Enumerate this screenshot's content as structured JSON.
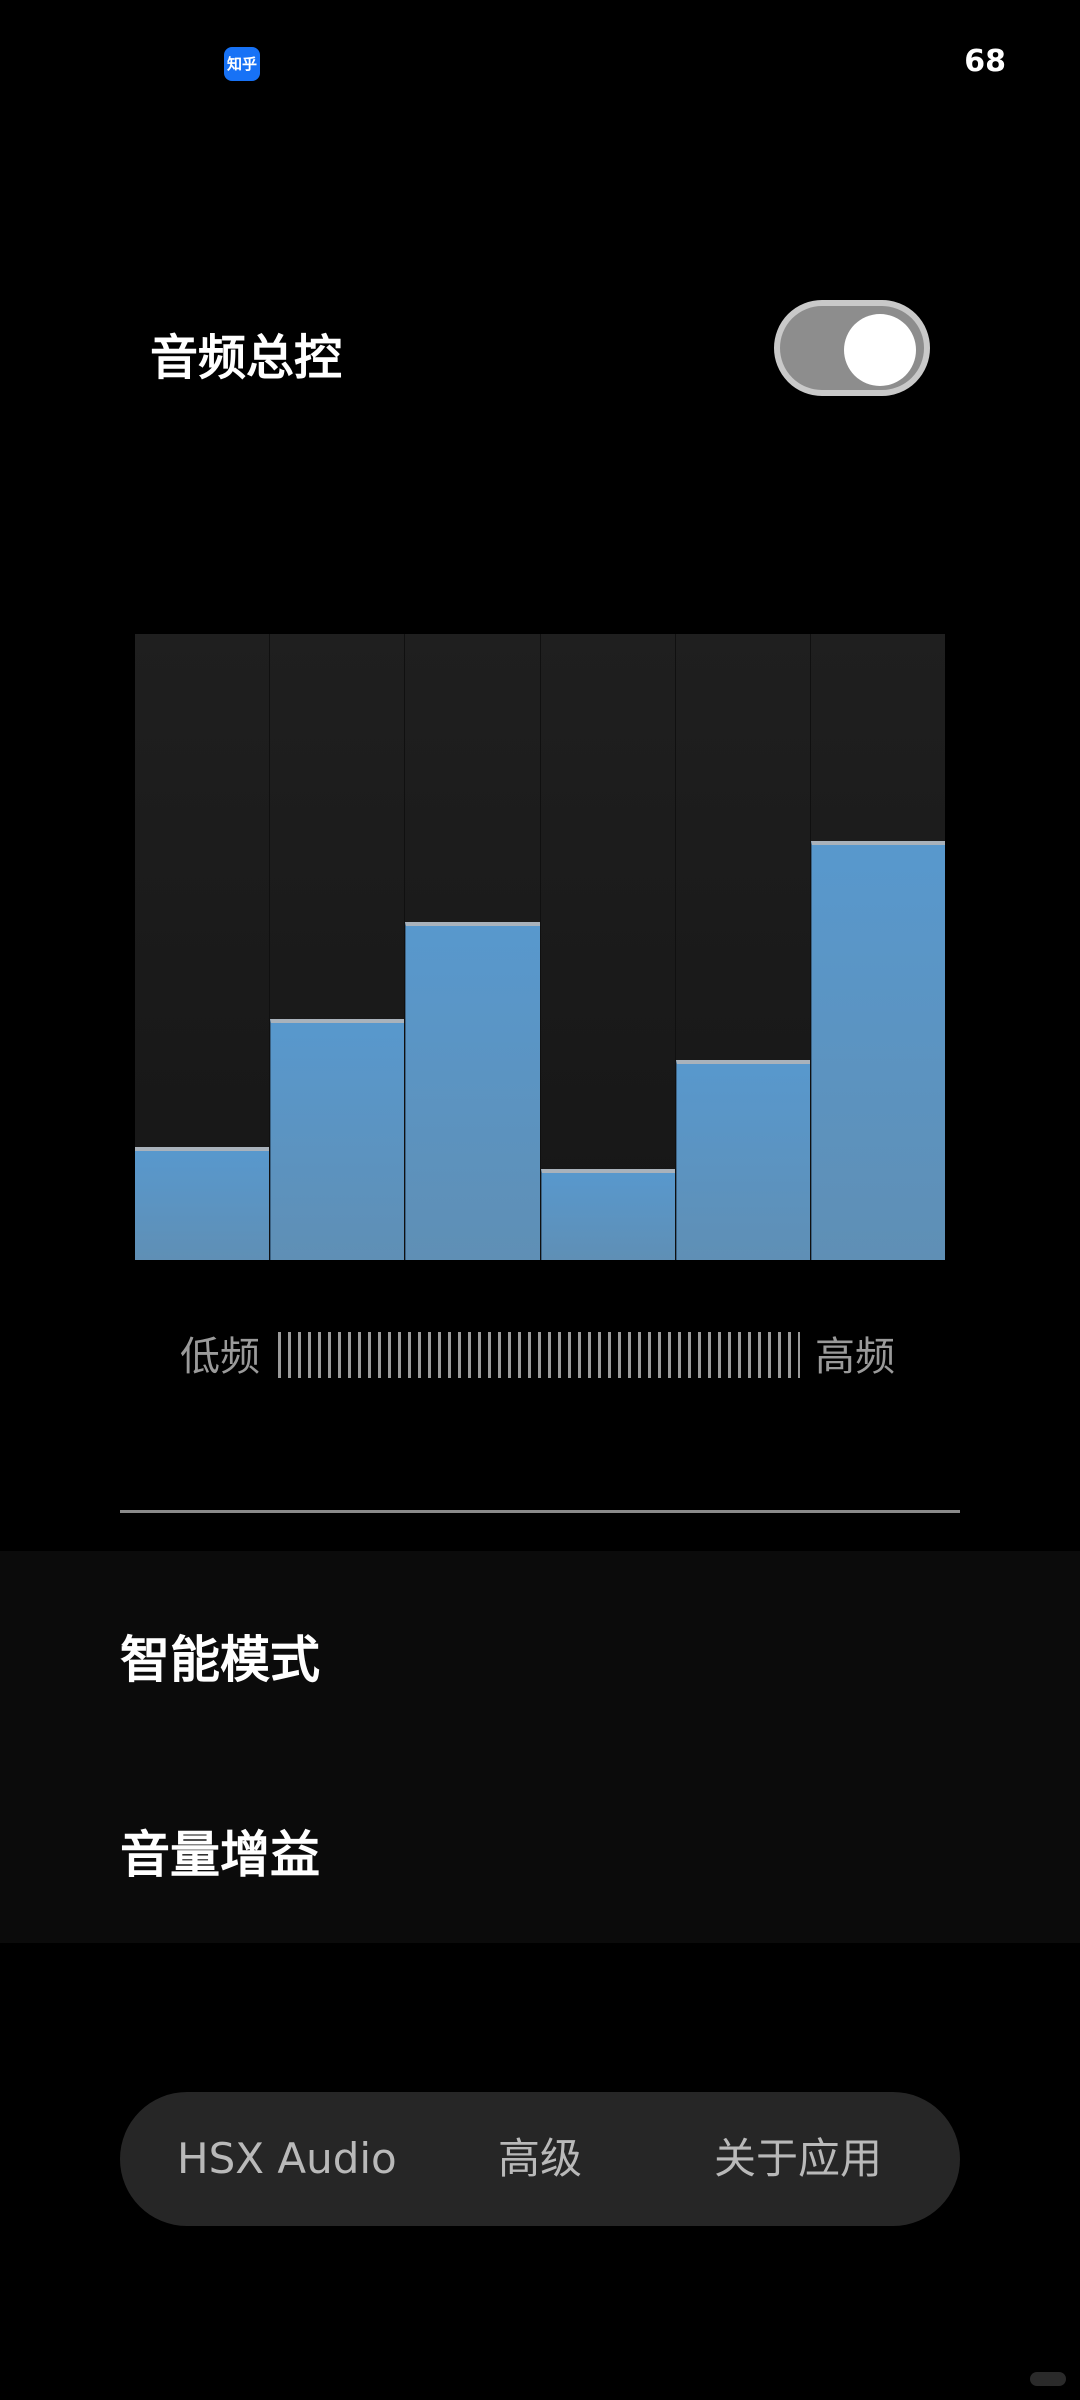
{
  "status_bar": {
    "app_icon_label": "知乎",
    "battery": "68"
  },
  "master_control": {
    "label": "音频总控",
    "enabled": true
  },
  "equalizer": {
    "bands": [
      {
        "level": 0.18
      },
      {
        "level": 0.385
      },
      {
        "level": 0.54
      },
      {
        "level": 0.145
      },
      {
        "level": 0.32
      },
      {
        "level": 0.67
      }
    ],
    "accent_color": "#5898cd"
  },
  "frequency_scale": {
    "low_label": "低频",
    "high_label": "高频"
  },
  "settings": {
    "items": [
      {
        "label": "智能模式"
      },
      {
        "label": "音量增益"
      }
    ]
  },
  "bottom_nav": {
    "items": [
      {
        "label": "HSX Audio"
      },
      {
        "label": "高级"
      },
      {
        "label": "关于应用"
      }
    ]
  }
}
